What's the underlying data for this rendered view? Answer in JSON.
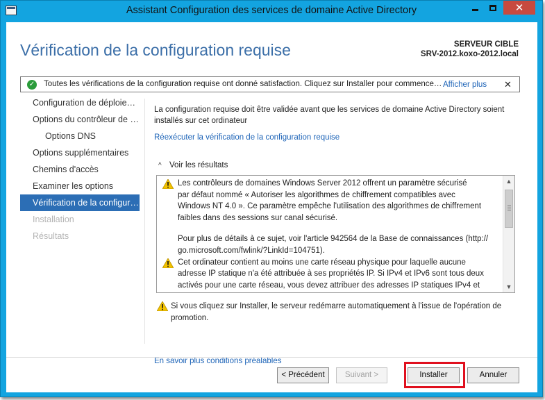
{
  "window": {
    "title": "Assistant Configuration des services de domaine Active Directory",
    "minimize_symbol": "",
    "maximize_symbol": "",
    "close_symbol": "✕"
  },
  "header": {
    "page_title": "Vérification de la configuration requise",
    "server_label": "SERVEUR CIBLE",
    "server_name": "SRV-2012.koxo-2012.local"
  },
  "notification": {
    "text": "Toutes les vérifications de la configuration requise ont donné satisfaction. Cliquez sur Installer pour commencer l'installation.",
    "link": "Afficher plus",
    "close": "✕"
  },
  "sidebar": {
    "items": [
      {
        "label": "Configuration de déploiement",
        "state": "normal",
        "level": 0
      },
      {
        "label": "Options du contrôleur de domaine",
        "state": "normal",
        "level": 0
      },
      {
        "label": "Options DNS",
        "state": "normal",
        "level": 1
      },
      {
        "label": "Options supplémentaires",
        "state": "normal",
        "level": 0
      },
      {
        "label": "Chemins d'accès",
        "state": "normal",
        "level": 0
      },
      {
        "label": "Examiner les options",
        "state": "normal",
        "level": 0
      },
      {
        "label": "Vérification de la configuration requise",
        "state": "active",
        "level": 0
      },
      {
        "label": "Installation",
        "state": "disabled",
        "level": 0
      },
      {
        "label": "Résultats",
        "state": "disabled",
        "level": 0
      }
    ]
  },
  "main": {
    "intro": "La configuration requise doit être validée avant que les services de domaine Active Directory soient installés sur cet ordinateur",
    "rerun_link": "Réexécuter la vérification de la configuration requise",
    "results_toggle": "Voir les résultats",
    "results": [
      {
        "icon": "warning-icon",
        "lines": [
          "Les contrôleurs de domaines Windows Server 2012 offrent un paramètre sécurisé",
          "par défaut nommé « Autoriser les algorithmes de chiffrement compatibles avec",
          "Windows NT 4.0 ». Ce paramètre empêche l'utilisation des algorithmes de chiffrement",
          "faibles dans des sessions sur canal sécurisé."
        ],
        "extra_lines": [
          "Pour plus de détails à ce sujet, voir l'article 942564 de la Base de connaissances (http://",
          "go.microsoft.com/fwlink/?LinkId=104751)."
        ]
      },
      {
        "icon": "warning-icon",
        "lines": [
          "Cet ordinateur contient au moins une carte réseau physique pour laquelle aucune",
          "adresse IP statique n'a été attribuée à ses propriétés IP. Si IPv4 et IPv6 sont tous deux",
          "activés pour une carte réseau, vous devez attribuer des adresses IP statiques IPv4 et"
        ]
      }
    ],
    "restart_warning_lines": [
      "Si vous cliquez sur Installer, le serveur redémarre automatiquement à l'issue de l'opération de",
      "promotion."
    ],
    "more_link": "En savoir plus conditions préalables"
  },
  "footer": {
    "previous": "< Précédent",
    "next": "Suivant >",
    "install": "Installer",
    "cancel": "Annuler"
  },
  "colors": {
    "frame": "#13a4e0",
    "title_blue": "#3c6fa8",
    "link_blue": "#1c63b7",
    "active_nav": "#2c6eb5",
    "success_green": "#2b9c3b",
    "warning_yellow": "#f2c200",
    "highlight_red": "#e0101e",
    "close_red": "#c74a3f"
  }
}
